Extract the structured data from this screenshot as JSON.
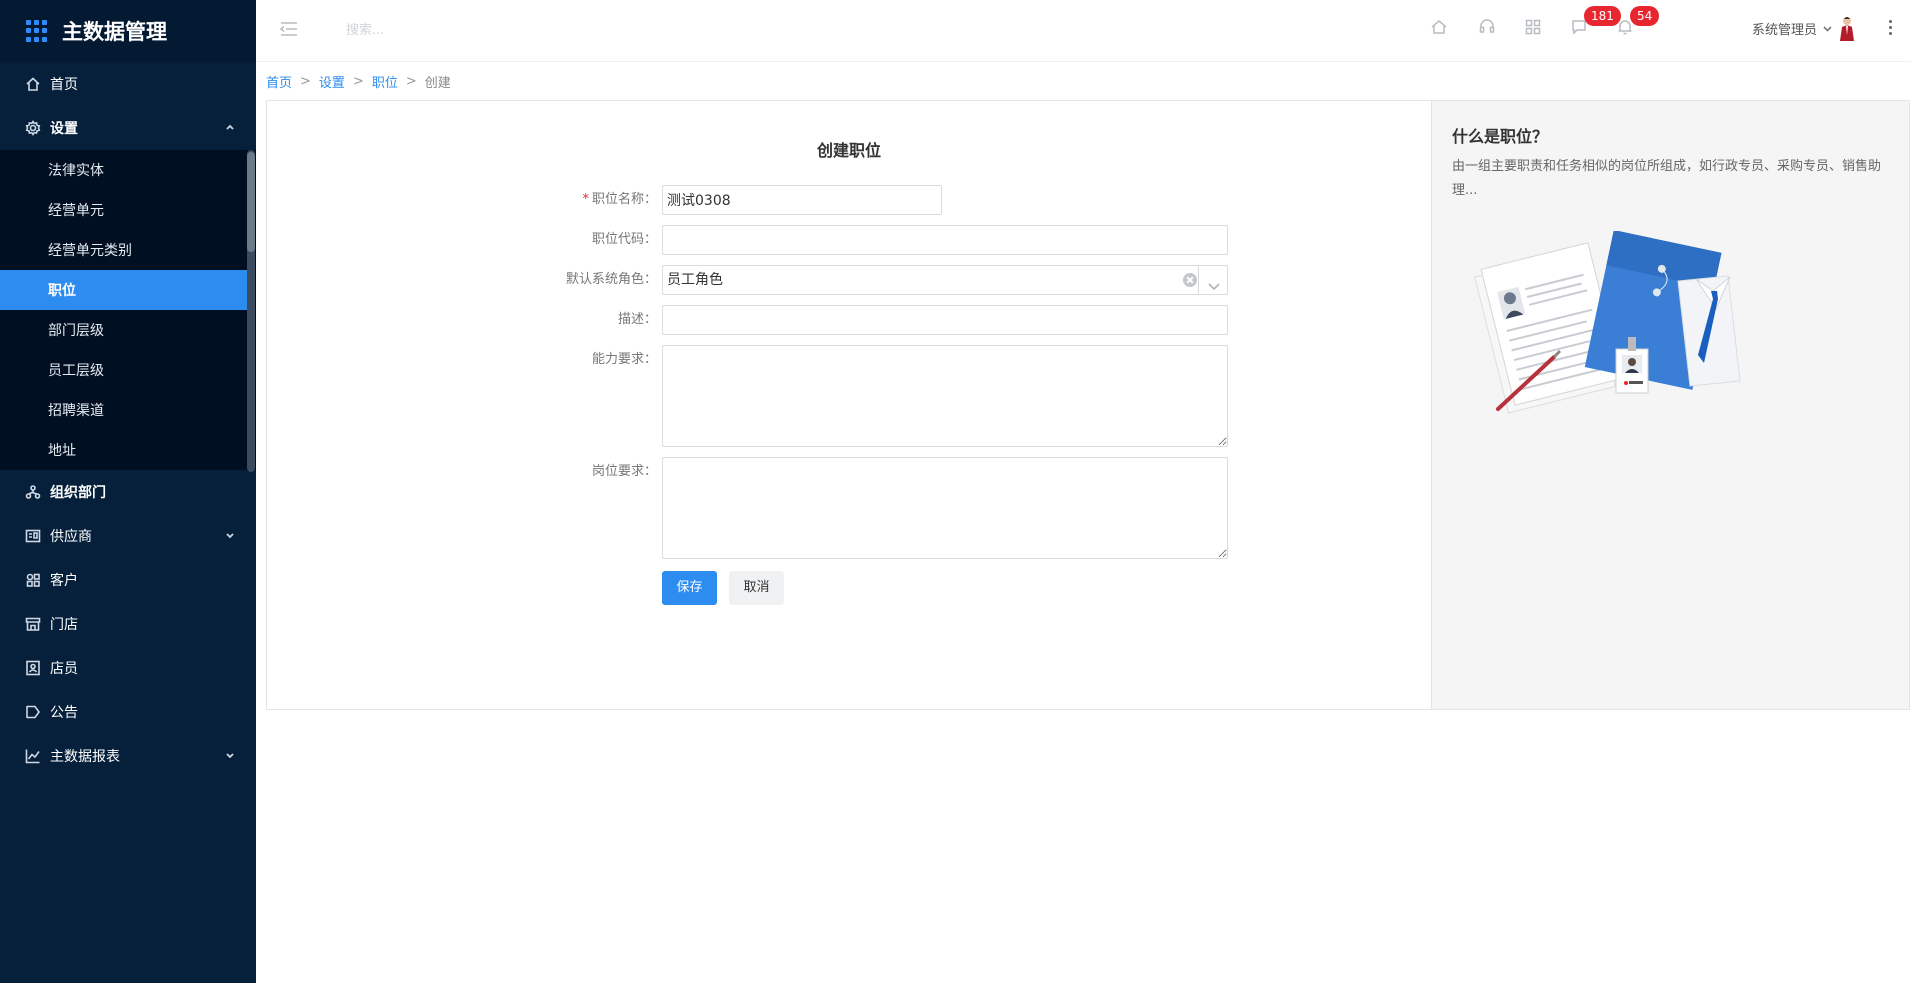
{
  "app": {
    "title": "主数据管理"
  },
  "sidebar": {
    "items": [
      {
        "label": "首页",
        "icon": "home-icon"
      },
      {
        "label": "设置",
        "icon": "gear-icon"
      },
      {
        "label": "组织部门",
        "icon": "org-icon"
      },
      {
        "label": "供应商",
        "icon": "supplier-icon"
      },
      {
        "label": "客户",
        "icon": "customer-icon"
      },
      {
        "label": "门店",
        "icon": "store-icon"
      },
      {
        "label": "店员",
        "icon": "clerk-icon"
      },
      {
        "label": "公告",
        "icon": "announce-icon"
      },
      {
        "label": "主数据报表",
        "icon": "chart-icon"
      }
    ],
    "settings_sub": [
      {
        "label": "法律实体"
      },
      {
        "label": "经营单元"
      },
      {
        "label": "经营单元类别"
      },
      {
        "label": "职位",
        "active": true
      },
      {
        "label": "部门层级"
      },
      {
        "label": "员工层级"
      },
      {
        "label": "招聘渠道"
      },
      {
        "label": "地址"
      }
    ],
    "active_color": "#2d8cf0"
  },
  "header": {
    "search_placeholder": "搜索...",
    "badges": {
      "messages": "181",
      "notifications": "54"
    },
    "user_name": "系统管理员"
  },
  "breadcrumb": {
    "home": "首页",
    "settings": "设置",
    "position": "职位",
    "current": "创建",
    "sep": ">"
  },
  "form": {
    "title": "创建职位",
    "fields": {
      "name": {
        "label": "职位名称：",
        "value": "测试0308",
        "required": "*"
      },
      "code": {
        "label": "职位代码：",
        "value": ""
      },
      "role": {
        "label": "默认系统角色：",
        "value": "员工角色"
      },
      "desc": {
        "label": "描述：",
        "value": ""
      },
      "ability": {
        "label": "能力要求：",
        "value": ""
      },
      "post": {
        "label": "岗位要求：",
        "value": ""
      }
    },
    "save_label": "保存",
    "cancel_label": "取消"
  },
  "help": {
    "title": "什么是职位？",
    "text": "由一组主要职责和任务相似的岗位所组成，如行政专员、采购专员、销售助理..."
  }
}
